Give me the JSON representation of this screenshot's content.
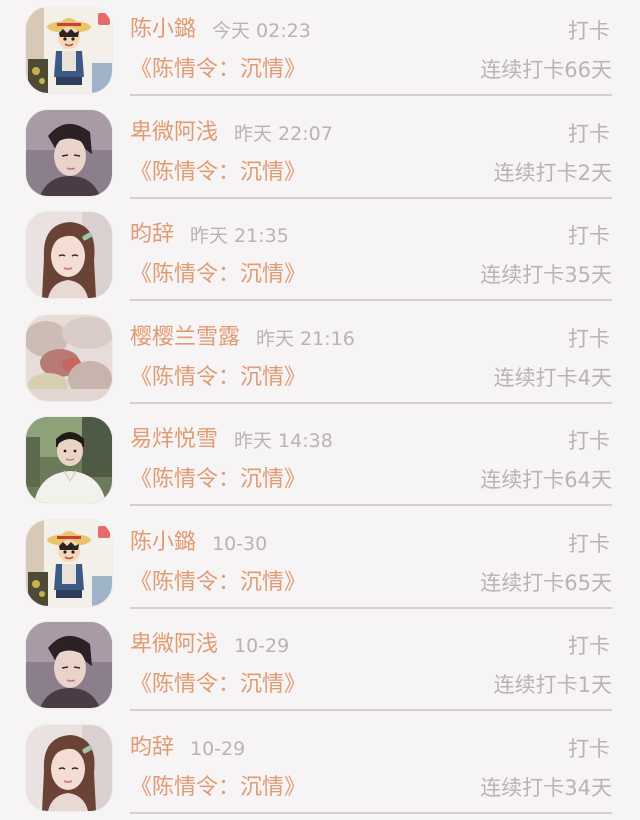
{
  "feed": {
    "items": [
      {
        "name": "陈小鏴",
        "time": "今天 02:23",
        "action": "打卡",
        "book": "《陈情令：沉情》",
        "streak": "连续打卡66天",
        "avatar": "straw-hat-cartoon-avatar"
      },
      {
        "name": "卑微阿浅",
        "time": "昨天 22:07",
        "action": "打卡",
        "book": "《陈情令：沉情》",
        "streak": "连续打卡2天",
        "avatar": "man-portrait-avatar"
      },
      {
        "name": "昀辞",
        "time": "昨天 21:35",
        "action": "打卡",
        "book": "《陈情令：沉情》",
        "streak": "连续打卡35天",
        "avatar": "girl-with-hairclip-avatar"
      },
      {
        "name": "樱樱兰雪露",
        "time": "昨天 21:16",
        "action": "打卡",
        "book": "《陈情令：沉情》",
        "streak": "连续打卡4天",
        "avatar": "blurred-photo-avatar"
      },
      {
        "name": "易烊悦雪",
        "time": "昨天 14:38",
        "action": "打卡",
        "book": "《陈情令：沉情》",
        "streak": "连续打卡64天",
        "avatar": "man-white-shirt-avatar"
      },
      {
        "name": "陈小鏴",
        "time": "10-30",
        "action": "打卡",
        "book": "《陈情令：沉情》",
        "streak": "连续打卡65天",
        "avatar": "straw-hat-cartoon-avatar"
      },
      {
        "name": "卑微阿浅",
        "time": "10-29",
        "action": "打卡",
        "book": "《陈情令：沉情》",
        "streak": "连续打卡1天",
        "avatar": "man-portrait-avatar"
      },
      {
        "name": "昀辞",
        "time": "10-29",
        "action": "打卡",
        "book": "《陈情令：沉情》",
        "streak": "连续打卡34天",
        "avatar": "girl-with-hairclip-avatar"
      }
    ]
  },
  "colors": {
    "background": "#f7f4f5",
    "accent": "#e19b72",
    "muted": "#b8b3b4",
    "divider": "#d4d0d1"
  }
}
